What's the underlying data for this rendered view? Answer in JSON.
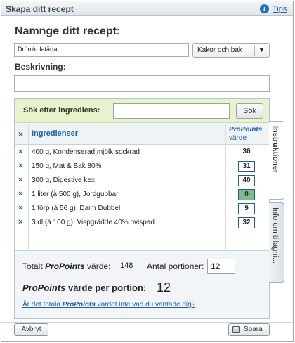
{
  "window": {
    "title": "Skapa ditt recept",
    "tips_label": "Tips",
    "help_glyph": "i"
  },
  "recipe": {
    "name_heading": "Namnge ditt recept:",
    "name_value": "Drömkolatårta",
    "category_value": "Kakor och bak",
    "description_heading": "Beskrivning:",
    "description_value": ""
  },
  "search": {
    "label": "Sök efter ingrediens:",
    "value": "",
    "button_label": "Sök"
  },
  "table": {
    "delete_header_glyph": "×",
    "ingredients_header": "Ingredienser",
    "value_header_italic": "ProPoints",
    "value_header_rest": "värde",
    "delete_glyph": "×",
    "rows": [
      {
        "text": "400 g, Kondenserad mjölk sockrad",
        "value": "36",
        "style": "plain"
      },
      {
        "text": "150 g, Mat & Bak 80%",
        "value": "31",
        "style": "boxed"
      },
      {
        "text": "300 g, Digestive kex",
        "value": "40",
        "style": "boxed"
      },
      {
        "text": "1 liter (à 500 g), Jordgubbar",
        "value": "0",
        "style": "green"
      },
      {
        "text": "1 förp (à 56 g), Daim Dubbel",
        "value": "9",
        "style": "boxed"
      },
      {
        "text": "3 dl (à 100 g), Vispgrädde 40% ovispad",
        "value": "32",
        "style": "boxed"
      }
    ]
  },
  "summary": {
    "total_prefix": "Totalt ",
    "total_italic": "ProPoints",
    "total_suffix": " värde:",
    "total_value": "148",
    "portions_label": "Antal portioner:",
    "portions_value": "12",
    "per_portion_italic": "ProPoints",
    "per_portion_suffix": " värde per portion:",
    "per_portion_value": "12",
    "mismatch_prefix": "Är det totala ",
    "mismatch_italic": "ProPoints",
    "mismatch_suffix": " värdet inte vad du väntade dig?"
  },
  "side_tabs": [
    {
      "label": "Instruktioner",
      "active": true
    },
    {
      "label": "Info om tillagni...",
      "active": false
    }
  ],
  "footer": {
    "cancel_label": "Avbryt",
    "save_label": "Spara"
  },
  "colors": {
    "accent": "#1f5fa8",
    "search_bg": "#e6f3cc",
    "zero_value_bg": "#7bbd8a"
  }
}
